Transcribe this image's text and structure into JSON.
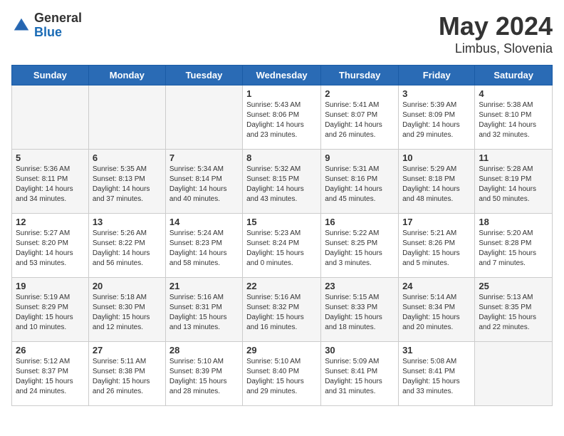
{
  "header": {
    "logo_general": "General",
    "logo_blue": "Blue",
    "month_title": "May 2024",
    "location": "Limbus, Slovenia"
  },
  "calendar": {
    "days_of_week": [
      "Sunday",
      "Monday",
      "Tuesday",
      "Wednesday",
      "Thursday",
      "Friday",
      "Saturday"
    ],
    "weeks": [
      [
        {
          "day": "",
          "sunrise": "",
          "sunset": "",
          "daylight": ""
        },
        {
          "day": "",
          "sunrise": "",
          "sunset": "",
          "daylight": ""
        },
        {
          "day": "",
          "sunrise": "",
          "sunset": "",
          "daylight": ""
        },
        {
          "day": "1",
          "sunrise": "Sunrise: 5:43 AM",
          "sunset": "Sunset: 8:06 PM",
          "daylight": "Daylight: 14 hours and 23 minutes."
        },
        {
          "day": "2",
          "sunrise": "Sunrise: 5:41 AM",
          "sunset": "Sunset: 8:07 PM",
          "daylight": "Daylight: 14 hours and 26 minutes."
        },
        {
          "day": "3",
          "sunrise": "Sunrise: 5:39 AM",
          "sunset": "Sunset: 8:09 PM",
          "daylight": "Daylight: 14 hours and 29 minutes."
        },
        {
          "day": "4",
          "sunrise": "Sunrise: 5:38 AM",
          "sunset": "Sunset: 8:10 PM",
          "daylight": "Daylight: 14 hours and 32 minutes."
        }
      ],
      [
        {
          "day": "5",
          "sunrise": "Sunrise: 5:36 AM",
          "sunset": "Sunset: 8:11 PM",
          "daylight": "Daylight: 14 hours and 34 minutes."
        },
        {
          "day": "6",
          "sunrise": "Sunrise: 5:35 AM",
          "sunset": "Sunset: 8:13 PM",
          "daylight": "Daylight: 14 hours and 37 minutes."
        },
        {
          "day": "7",
          "sunrise": "Sunrise: 5:34 AM",
          "sunset": "Sunset: 8:14 PM",
          "daylight": "Daylight: 14 hours and 40 minutes."
        },
        {
          "day": "8",
          "sunrise": "Sunrise: 5:32 AM",
          "sunset": "Sunset: 8:15 PM",
          "daylight": "Daylight: 14 hours and 43 minutes."
        },
        {
          "day": "9",
          "sunrise": "Sunrise: 5:31 AM",
          "sunset": "Sunset: 8:16 PM",
          "daylight": "Daylight: 14 hours and 45 minutes."
        },
        {
          "day": "10",
          "sunrise": "Sunrise: 5:29 AM",
          "sunset": "Sunset: 8:18 PM",
          "daylight": "Daylight: 14 hours and 48 minutes."
        },
        {
          "day": "11",
          "sunrise": "Sunrise: 5:28 AM",
          "sunset": "Sunset: 8:19 PM",
          "daylight": "Daylight: 14 hours and 50 minutes."
        }
      ],
      [
        {
          "day": "12",
          "sunrise": "Sunrise: 5:27 AM",
          "sunset": "Sunset: 8:20 PM",
          "daylight": "Daylight: 14 hours and 53 minutes."
        },
        {
          "day": "13",
          "sunrise": "Sunrise: 5:26 AM",
          "sunset": "Sunset: 8:22 PM",
          "daylight": "Daylight: 14 hours and 56 minutes."
        },
        {
          "day": "14",
          "sunrise": "Sunrise: 5:24 AM",
          "sunset": "Sunset: 8:23 PM",
          "daylight": "Daylight: 14 hours and 58 minutes."
        },
        {
          "day": "15",
          "sunrise": "Sunrise: 5:23 AM",
          "sunset": "Sunset: 8:24 PM",
          "daylight": "Daylight: 15 hours and 0 minutes."
        },
        {
          "day": "16",
          "sunrise": "Sunrise: 5:22 AM",
          "sunset": "Sunset: 8:25 PM",
          "daylight": "Daylight: 15 hours and 3 minutes."
        },
        {
          "day": "17",
          "sunrise": "Sunrise: 5:21 AM",
          "sunset": "Sunset: 8:26 PM",
          "daylight": "Daylight: 15 hours and 5 minutes."
        },
        {
          "day": "18",
          "sunrise": "Sunrise: 5:20 AM",
          "sunset": "Sunset: 8:28 PM",
          "daylight": "Daylight: 15 hours and 7 minutes."
        }
      ],
      [
        {
          "day": "19",
          "sunrise": "Sunrise: 5:19 AM",
          "sunset": "Sunset: 8:29 PM",
          "daylight": "Daylight: 15 hours and 10 minutes."
        },
        {
          "day": "20",
          "sunrise": "Sunrise: 5:18 AM",
          "sunset": "Sunset: 8:30 PM",
          "daylight": "Daylight: 15 hours and 12 minutes."
        },
        {
          "day": "21",
          "sunrise": "Sunrise: 5:16 AM",
          "sunset": "Sunset: 8:31 PM",
          "daylight": "Daylight: 15 hours and 13 minutes."
        },
        {
          "day": "22",
          "sunrise": "Sunrise: 5:16 AM",
          "sunset": "Sunset: 8:32 PM",
          "daylight": "Daylight: 15 hours and 16 minutes."
        },
        {
          "day": "23",
          "sunrise": "Sunrise: 5:15 AM",
          "sunset": "Sunset: 8:33 PM",
          "daylight": "Daylight: 15 hours and 18 minutes."
        },
        {
          "day": "24",
          "sunrise": "Sunrise: 5:14 AM",
          "sunset": "Sunset: 8:34 PM",
          "daylight": "Daylight: 15 hours and 20 minutes."
        },
        {
          "day": "25",
          "sunrise": "Sunrise: 5:13 AM",
          "sunset": "Sunset: 8:35 PM",
          "daylight": "Daylight: 15 hours and 22 minutes."
        }
      ],
      [
        {
          "day": "26",
          "sunrise": "Sunrise: 5:12 AM",
          "sunset": "Sunset: 8:37 PM",
          "daylight": "Daylight: 15 hours and 24 minutes."
        },
        {
          "day": "27",
          "sunrise": "Sunrise: 5:11 AM",
          "sunset": "Sunset: 8:38 PM",
          "daylight": "Daylight: 15 hours and 26 minutes."
        },
        {
          "day": "28",
          "sunrise": "Sunrise: 5:10 AM",
          "sunset": "Sunset: 8:39 PM",
          "daylight": "Daylight: 15 hours and 28 minutes."
        },
        {
          "day": "29",
          "sunrise": "Sunrise: 5:10 AM",
          "sunset": "Sunset: 8:40 PM",
          "daylight": "Daylight: 15 hours and 29 minutes."
        },
        {
          "day": "30",
          "sunrise": "Sunrise: 5:09 AM",
          "sunset": "Sunset: 8:41 PM",
          "daylight": "Daylight: 15 hours and 31 minutes."
        },
        {
          "day": "31",
          "sunrise": "Sunrise: 5:08 AM",
          "sunset": "Sunset: 8:41 PM",
          "daylight": "Daylight: 15 hours and 33 minutes."
        },
        {
          "day": "",
          "sunrise": "",
          "sunset": "",
          "daylight": ""
        }
      ]
    ]
  }
}
